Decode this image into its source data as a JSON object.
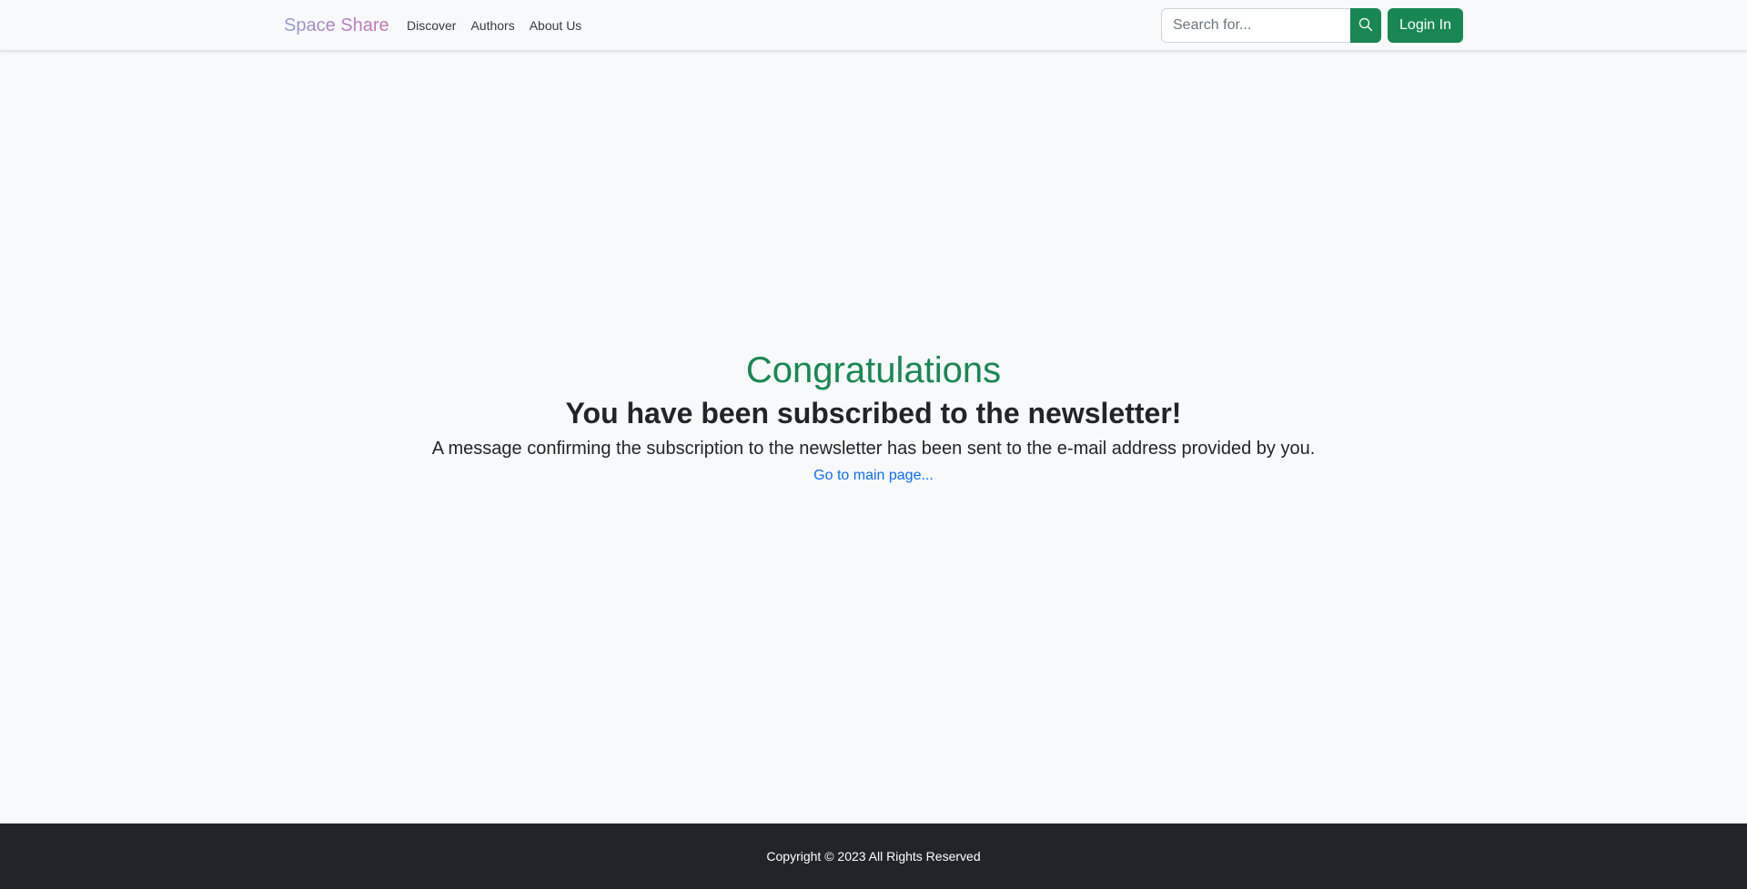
{
  "navbar": {
    "brand": "Space Share",
    "links": [
      {
        "label": "Discover"
      },
      {
        "label": "Authors"
      },
      {
        "label": "About Us"
      }
    ],
    "search": {
      "placeholder": "Search for...",
      "value": "",
      "button_icon": "search-icon"
    },
    "login_label": "Login In"
  },
  "main": {
    "heading": "Congratulations",
    "subheading": "You have been subscribed to the newsletter!",
    "description": "A message confirming the subscription to the newsletter has been sent to the e-mail address provided by you.",
    "link_label": "Go to main page..."
  },
  "footer": {
    "copyright": "Copyright © 2023 All Rights Reserved"
  },
  "colors": {
    "accent": "#198754",
    "link": "#0d6efd",
    "footer_bg": "#212529",
    "page_bg": "#f8f9fa"
  }
}
